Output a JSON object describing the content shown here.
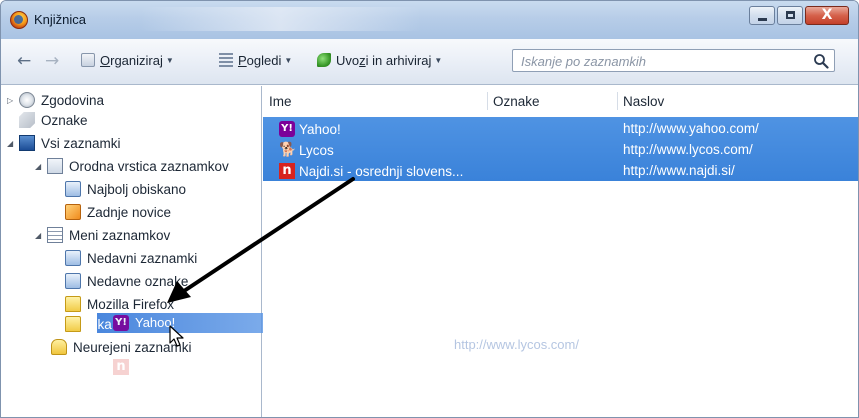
{
  "window": {
    "title": "Knjižnica"
  },
  "window_buttons": {
    "minimize": "–",
    "maximize": "□",
    "close": "X"
  },
  "toolbar": {
    "back": "←",
    "forward": "→",
    "organize_label": "Organiziraj",
    "organize_mnemonic": "O",
    "views_label": "Pogledi",
    "views_mnemonic": "P",
    "import_label": "Uvozi in arhiviraj",
    "import_mnemonic": "z",
    "dropdown_arrow": "▼"
  },
  "search": {
    "placeholder": "Iskanje po zaznamkih",
    "icon": "search-icon"
  },
  "tree": [
    {
      "label": "Zgodovina",
      "icon": "history-icon",
      "twisty": "▷"
    },
    {
      "label": "Oznake",
      "icon": "tags-icon",
      "twisty": ""
    },
    {
      "label": "Vsi zaznamki",
      "icon": "all-bookmarks-icon",
      "twisty": "◢"
    },
    {
      "label": "Orodna vrstica zaznamkov",
      "icon": "bookmarks-toolbar-icon",
      "twisty": "◢"
    },
    {
      "label": "Najbolj obiskano",
      "icon": "smart-folder-icon",
      "twisty": ""
    },
    {
      "label": "Zadnje novice",
      "icon": "rss-icon",
      "twisty": ""
    },
    {
      "label": "Meni zaznamkov",
      "icon": "bookmarks-menu-icon",
      "twisty": "◢"
    },
    {
      "label": "Nedavni zaznamki",
      "icon": "smart-folder-icon",
      "twisty": ""
    },
    {
      "label": "Nedavne oznake",
      "icon": "smart-folder-icon",
      "twisty": ""
    },
    {
      "label": "Mozilla Firefox",
      "icon": "folder-icon",
      "twisty": ""
    },
    {
      "label": "Iska",
      "icon": "folder-icon",
      "twisty": ""
    },
    {
      "label": "Neurejeni zaznamki",
      "icon": "unsorted-bookmarks-icon",
      "twisty": ""
    }
  ],
  "columns": {
    "name": "Ime",
    "tags": "Oznake",
    "location": "Naslov"
  },
  "bookmarks": [
    {
      "name": "Yahoo!",
      "url": "http://www.yahoo.com/",
      "favicon": "yahoo-icon",
      "glyph": "Y!"
    },
    {
      "name": "Lycos",
      "url": "http://www.lycos.com/",
      "favicon": "lycos-icon",
      "glyph": "🐕"
    },
    {
      "name": "Najdi.si - osrednji slovens...",
      "url": "http://www.najdi.si/",
      "favicon": "najdi-icon",
      "glyph": "n"
    }
  ],
  "drag_ghost": {
    "name": "Yahoo!",
    "url": "http://www.yahoo.com/",
    "url2": "http://www.lycos.com/",
    "name3": "Najdi.si - osrednji slovens..."
  },
  "colors": {
    "selection": "#3a82d9",
    "titlebar": "#b7cde8",
    "arrow": "#000000"
  }
}
